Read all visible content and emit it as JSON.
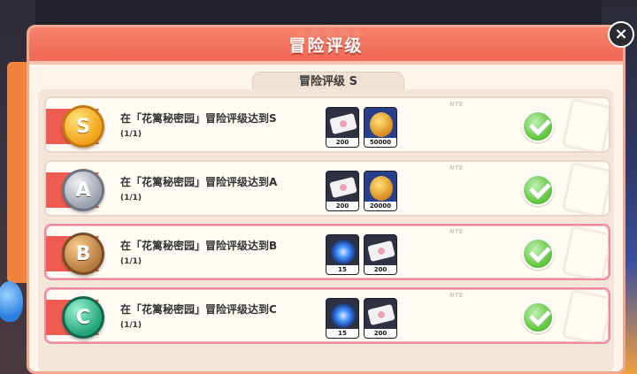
{
  "header": {
    "title": "冒险评级",
    "close_label": "×"
  },
  "subtab": {
    "label": "冒险评级 S"
  },
  "tag_text": "NTE",
  "rows": [
    {
      "medal_letter": "S",
      "title": "在「花篱秘密园」冒险评级达到S",
      "progress": "(1/1)",
      "rewards": [
        {
          "type": "ticket",
          "count": "200"
        },
        {
          "type": "coin",
          "count": "50000"
        }
      ],
      "completed": true
    },
    {
      "medal_letter": "A",
      "title": "在「花篱秘密园」冒险评级达到A",
      "progress": "(1/1)",
      "rewards": [
        {
          "type": "ticket",
          "count": "200"
        },
        {
          "type": "coin",
          "count": "20000"
        }
      ],
      "completed": true
    },
    {
      "medal_letter": "B",
      "title": "在「花篱秘密园」冒险评级达到B",
      "progress": "(1/1)",
      "rewards": [
        {
          "type": "orb",
          "count": "15"
        },
        {
          "type": "ticket",
          "count": "200"
        }
      ],
      "completed": true
    },
    {
      "medal_letter": "C",
      "title": "在「花篱秘密园」冒险评级达到C",
      "progress": "(1/1)",
      "rewards": [
        {
          "type": "orb",
          "count": "15"
        },
        {
          "type": "ticket",
          "count": "200"
        }
      ],
      "completed": true
    }
  ]
}
